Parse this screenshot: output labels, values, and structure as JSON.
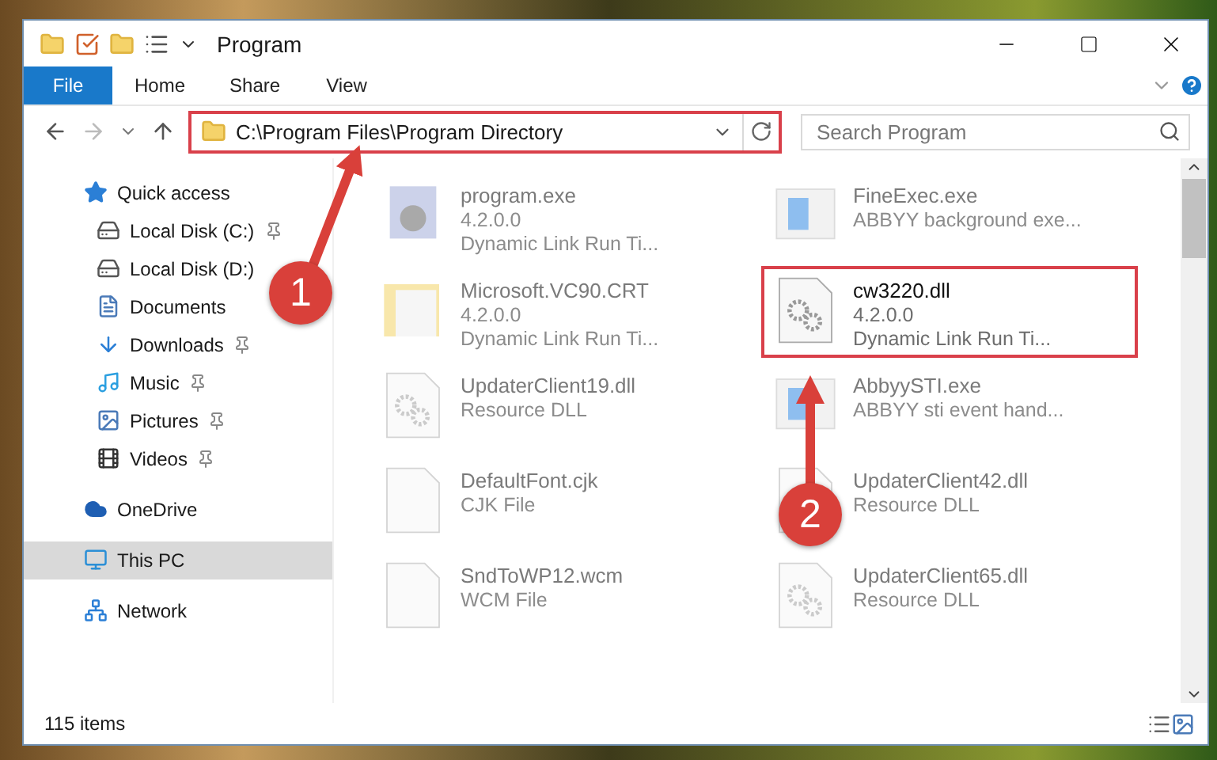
{
  "window": {
    "title": "Program"
  },
  "ribbon_tabs": [
    {
      "label": "File",
      "selected": true
    },
    {
      "label": "Home",
      "selected": false
    },
    {
      "label": "Share",
      "selected": false
    },
    {
      "label": "View",
      "selected": false
    }
  ],
  "address": {
    "path": "C:\\Program Files\\Program Directory",
    "highlighted": true
  },
  "search": {
    "placeholder": "Search Program"
  },
  "sidebar": {
    "items": [
      {
        "label": "Quick access",
        "kind": "star",
        "selected": false,
        "children": [
          {
            "label": "Local Disk (C:)",
            "kind": "disk",
            "selected": false,
            "pinned": true
          },
          {
            "label": "Local Disk (D:)",
            "kind": "disk",
            "selected": false,
            "pinned": false
          },
          {
            "label": "Documents",
            "kind": "documents",
            "selected": false,
            "pinned": false
          },
          {
            "label": "Downloads",
            "kind": "downloads",
            "selected": false,
            "pinned": true
          },
          {
            "label": "Music",
            "kind": "music",
            "selected": false,
            "pinned": true
          },
          {
            "label": "Pictures",
            "kind": "pictures",
            "selected": false,
            "pinned": true
          },
          {
            "label": "Videos",
            "kind": "videos",
            "selected": false,
            "pinned": true
          }
        ]
      },
      {
        "label": "OneDrive",
        "kind": "cloud",
        "selected": false
      },
      {
        "label": "This PC",
        "kind": "pc",
        "selected": true
      },
      {
        "label": "Network",
        "kind": "network",
        "selected": false
      }
    ]
  },
  "files": [
    {
      "name": "program.exe",
      "details": [
        "4.2.0.0",
        "Dynamic Link Run Ti..."
      ],
      "kind": "exe",
      "dimmed": true,
      "highlighted": false
    },
    {
      "name": "Microsoft.VC90.CRT",
      "details": [
        "4.2.0.0",
        "Dynamic Link Run Ti..."
      ],
      "kind": "folder",
      "dimmed": true,
      "highlighted": false
    },
    {
      "name": "UpdaterClient19.dll",
      "details": [
        "Resource DLL"
      ],
      "kind": "dll",
      "dimmed": true,
      "highlighted": false
    },
    {
      "name": "DefaultFont.cjk",
      "details": [
        "CJK File"
      ],
      "kind": "file",
      "dimmed": true,
      "highlighted": false
    },
    {
      "name": "SndToWP12.wcm",
      "details": [
        "WCM File"
      ],
      "kind": "file",
      "dimmed": true,
      "highlighted": false
    },
    {
      "name": "FineExec.exe",
      "details": [
        "ABBYY background exe..."
      ],
      "kind": "app",
      "dimmed": true,
      "highlighted": false
    },
    {
      "name": "cw3220.dll",
      "details": [
        "4.2.0.0",
        "Dynamic Link Run Ti..."
      ],
      "kind": "dll",
      "dimmed": false,
      "highlighted": true
    },
    {
      "name": "AbbyySTI.exe",
      "details": [
        "ABBYY sti event hand..."
      ],
      "kind": "app",
      "dimmed": true,
      "highlighted": false
    },
    {
      "name": "UpdaterClient42.dll",
      "details": [
        "Resource DLL"
      ],
      "kind": "dll",
      "dimmed": true,
      "highlighted": false
    },
    {
      "name": "UpdaterClient65.dll",
      "details": [
        "Resource DLL"
      ],
      "kind": "dll",
      "dimmed": true,
      "highlighted": false
    }
  ],
  "status_bar": {
    "item_count": "115 items"
  },
  "annotations": [
    {
      "number": "1"
    },
    {
      "number": "2"
    }
  ]
}
